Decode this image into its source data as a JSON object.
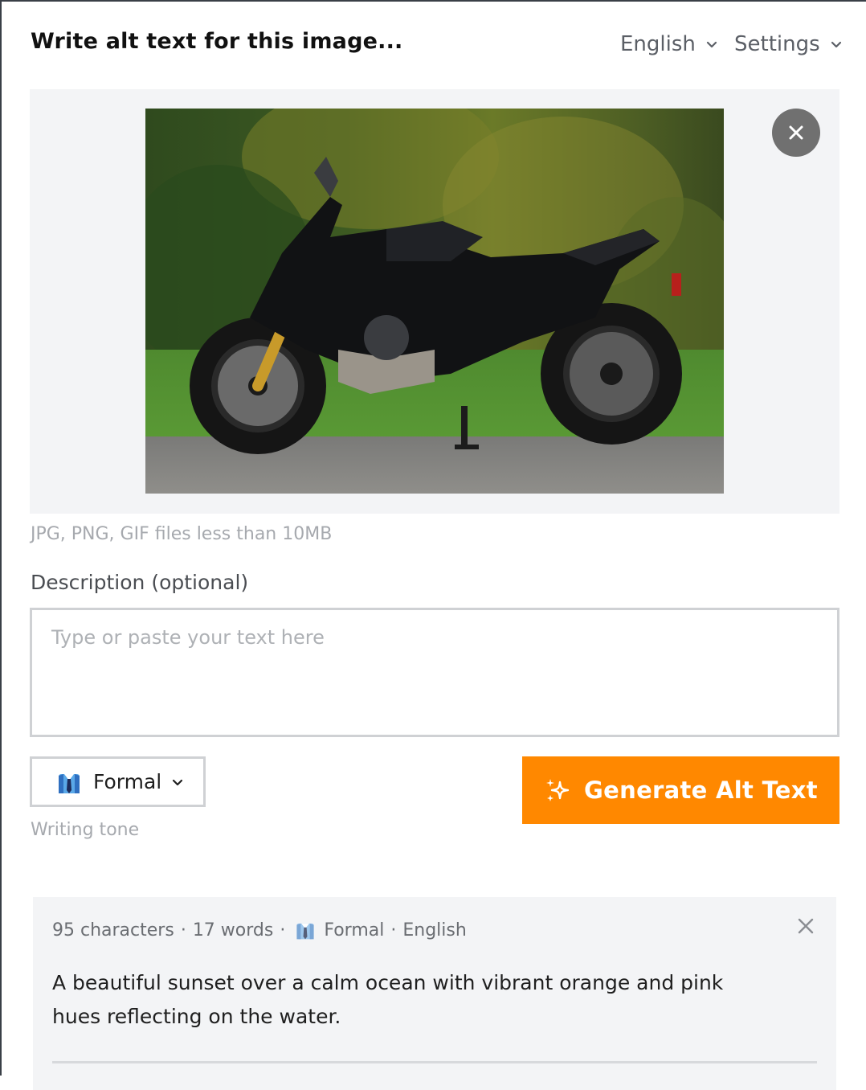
{
  "header": {
    "title": "Write alt text for this image...",
    "language_label": "English",
    "settings_label": "Settings"
  },
  "upload": {
    "file_hint": "JPG, PNG, GIF files less than 10MB"
  },
  "description": {
    "label": "Description (optional)",
    "placeholder": "Type or paste your text here",
    "value": ""
  },
  "tone": {
    "selected": "Formal",
    "hint": "Writing tone",
    "icon": "necktie-shirt-icon"
  },
  "generate": {
    "label": "Generate Alt Text",
    "icon": "sparkles-icon",
    "color": "#ff8800"
  },
  "result": {
    "characters": "95 characters",
    "words": "17 words",
    "tone": "Formal",
    "language": "English",
    "text": "A beautiful sunset over a calm ocean with vibrant orange and pink hues reflecting on the water."
  }
}
